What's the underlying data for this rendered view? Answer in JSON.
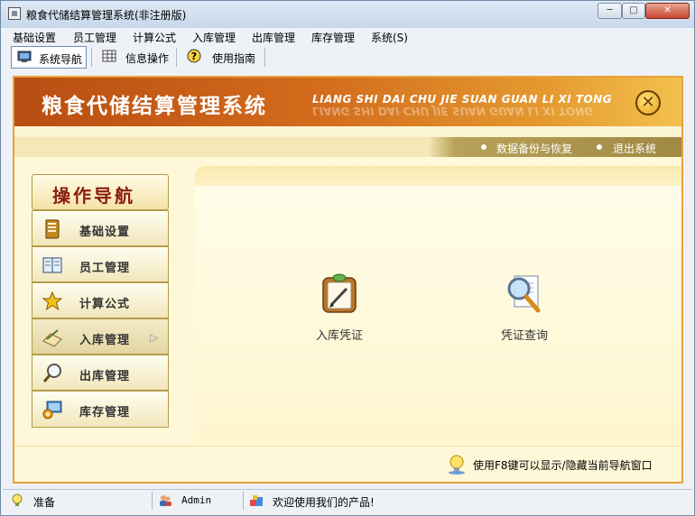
{
  "window": {
    "title": "粮食代储结算管理系统(非注册版)",
    "controls": {
      "minimize": "─",
      "maximize": "□",
      "close": "✕"
    }
  },
  "menu": [
    "基础设置",
    "员工管理",
    "计算公式",
    "入库管理",
    "出库管理",
    "库存管理",
    "系统(S)"
  ],
  "toolbar": {
    "items": [
      {
        "label": "系统导航",
        "icon": "monitor-icon",
        "active": true
      },
      {
        "label": "信息操作",
        "icon": "grid-icon",
        "active": false
      },
      {
        "label": "使用指南",
        "icon": "help-icon",
        "active": false
      }
    ]
  },
  "banner": {
    "title": "粮食代储结算管理系统",
    "pinyin": "LIANG SHI DAI CHU JIE SUAN GUAN LI XI TONG",
    "close_icon": "close-circle-icon"
  },
  "subbar": {
    "links": [
      "数据备份与恢复",
      "退出系统"
    ]
  },
  "nav": {
    "heading": "操作导航",
    "items": [
      {
        "label": "基础设置",
        "icon": "document-icon"
      },
      {
        "label": "员工管理",
        "icon": "book-icon"
      },
      {
        "label": "计算公式",
        "icon": "star-icon"
      },
      {
        "label": "入库管理",
        "icon": "pencil-paper-icon",
        "selected": true
      },
      {
        "label": "出库管理",
        "icon": "magnifier-icon"
      },
      {
        "label": "库存管理",
        "icon": "monitor-gear-icon"
      }
    ]
  },
  "content": {
    "functions": [
      {
        "label": "入库凭证",
        "icon": "clipboard-pen-icon"
      },
      {
        "label": "凭证查询",
        "icon": "document-search-icon"
      }
    ]
  },
  "hint": {
    "text": "使用F8键可以显示/隐藏当前导航窗口",
    "icon": "lightbulb-icon"
  },
  "status": {
    "ready": "准备",
    "user": "Admin",
    "message": "欢迎使用我们的产品!"
  },
  "colors": {
    "banner_start": "#b84d12",
    "banner_end": "#f2c14e",
    "frame_border": "#e8a23a",
    "nav_heading_text": "#8a1d10"
  }
}
